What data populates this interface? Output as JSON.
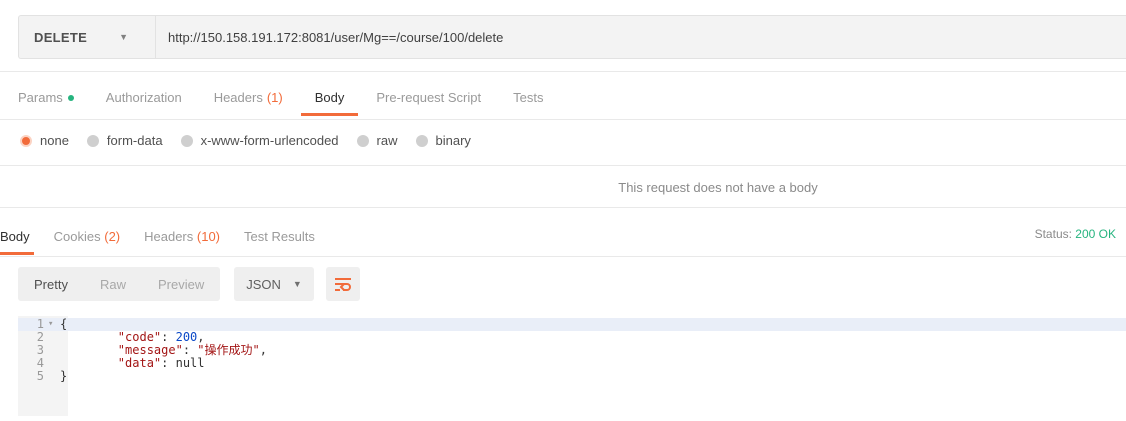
{
  "request": {
    "method": "DELETE",
    "url": "http://150.158.191.172:8081/user/Mg==/course/100/delete"
  },
  "request_tabs": [
    {
      "label": "Params",
      "count": "",
      "dot": true,
      "active": false
    },
    {
      "label": "Authorization",
      "count": "",
      "dot": false,
      "active": false
    },
    {
      "label": "Headers",
      "count": "(1)",
      "dot": false,
      "active": false
    },
    {
      "label": "Body",
      "count": "",
      "dot": false,
      "active": true
    },
    {
      "label": "Pre-request Script",
      "count": "",
      "dot": false,
      "active": false
    },
    {
      "label": "Tests",
      "count": "",
      "dot": false,
      "active": false
    }
  ],
  "body_types": [
    {
      "label": "none",
      "active": true
    },
    {
      "label": "form-data",
      "active": false
    },
    {
      "label": "x-www-form-urlencoded",
      "active": false
    },
    {
      "label": "raw",
      "active": false
    },
    {
      "label": "binary",
      "active": false
    }
  ],
  "no_body_text": "This request does not have a body",
  "response_tabs": [
    {
      "label": "Body",
      "count": "",
      "active": true
    },
    {
      "label": "Cookies",
      "count": "(2)",
      "active": false
    },
    {
      "label": "Headers",
      "count": "(10)",
      "active": false
    },
    {
      "label": "Test Results",
      "count": "",
      "active": false
    }
  ],
  "status": {
    "label": "Status:",
    "value": "200 OK"
  },
  "format_buttons": [
    {
      "label": "Pretty",
      "active": true
    },
    {
      "label": "Raw",
      "active": false
    },
    {
      "label": "Preview",
      "active": false
    }
  ],
  "format_select": "JSON",
  "colors": {
    "accent": "#f26b3a",
    "success": "#26b47f"
  },
  "code_lines": [
    {
      "n": "1",
      "text": "{"
    },
    {
      "n": "2",
      "key": "\"code\"",
      "sep": ": ",
      "value": "200",
      "vtype": "num",
      "tail": ","
    },
    {
      "n": "3",
      "key": "\"message\"",
      "sep": ": ",
      "value": "\"操作成功\"",
      "vtype": "str",
      "tail": ","
    },
    {
      "n": "4",
      "key": "\"data\"",
      "sep": ": ",
      "value": "null",
      "vtype": "kw",
      "tail": ""
    },
    {
      "n": "5",
      "text": "}"
    }
  ]
}
